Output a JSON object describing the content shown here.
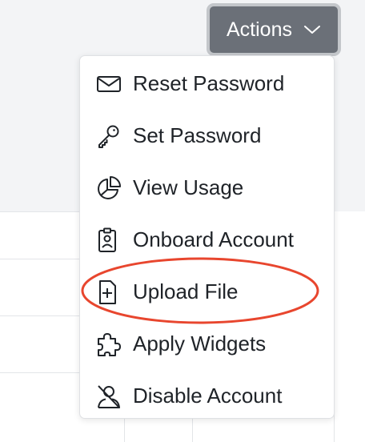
{
  "actions_button": {
    "label": "Actions",
    "icon": "chevron-down-icon"
  },
  "menu": {
    "items": [
      {
        "label": "Reset Password",
        "icon": "envelope-icon"
      },
      {
        "label": "Set Password",
        "icon": "key-icon"
      },
      {
        "label": "View Usage",
        "icon": "pie-chart-icon"
      },
      {
        "label": "Onboard Account",
        "icon": "badge-icon"
      },
      {
        "label": "Upload File",
        "icon": "file-plus-icon"
      },
      {
        "label": "Apply Widgets",
        "icon": "puzzle-icon"
      },
      {
        "label": "Disable Account",
        "icon": "person-slash-icon"
      }
    ]
  },
  "colors": {
    "button_bg": "#6b7078",
    "highlight_oval": "#e8462e",
    "menu_text": "#1f2328"
  }
}
